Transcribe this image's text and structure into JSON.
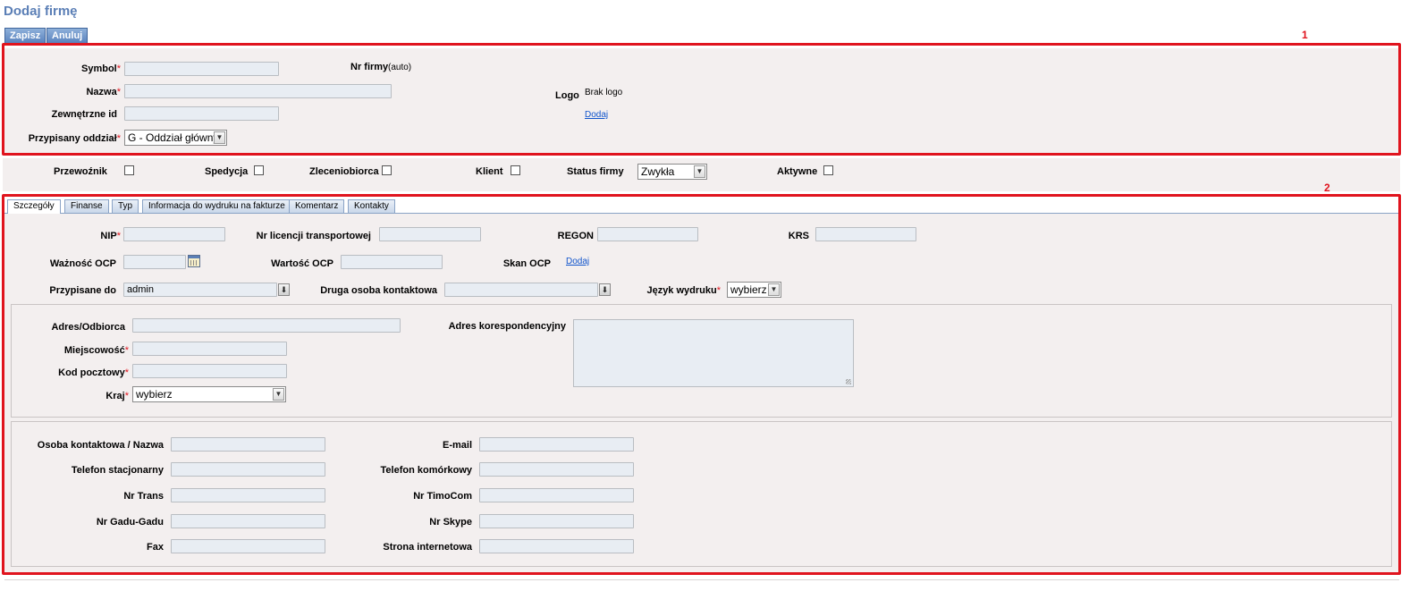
{
  "page": {
    "title": "Dodaj firmę"
  },
  "toolbar": {
    "save_label": "Zapisz",
    "cancel_label": "Anuluj"
  },
  "annotations": {
    "box1": "1",
    "box2": "2"
  },
  "basic": {
    "symbol_label": "Symbol",
    "name_label": "Nazwa",
    "external_id_label": "Zewnętrzne id",
    "branch_label": "Przypisany oddział",
    "branch_value": "G - Oddział główny",
    "company_no_label": "Nr firmy",
    "company_no_value": "(auto)",
    "logo_label": "Logo",
    "logo_value": "Brak logo",
    "logo_add_link": "Dodaj"
  },
  "flags": {
    "carrier_label": "Przewoźnik",
    "forwarding_label": "Spedycja",
    "client_order_label": "Zleceniobiorca",
    "client_label": "Klient",
    "status_label": "Status firmy",
    "status_value": "Zwykła",
    "active_label": "Aktywne"
  },
  "tabs": [
    {
      "label": "Szczegóły",
      "active": true
    },
    {
      "label": "Finanse"
    },
    {
      "label": "Typ"
    },
    {
      "label": "Informacja do wydruku na fakturze"
    },
    {
      "label": "Komentarz"
    },
    {
      "label": "Kontakty"
    }
  ],
  "details": {
    "nip_label": "NIP",
    "license_label": "Nr licencji transportowej",
    "regon_label": "REGON",
    "krs_label": "KRS",
    "ocp_validity_label": "Ważność OCP",
    "ocp_value_label": "Wartość OCP",
    "ocp_scan_label": "Skan OCP",
    "ocp_scan_link": "Dodaj",
    "assigned_label": "Przypisane do",
    "assigned_value": "admin",
    "second_contact_label": "Druga osoba kontaktowa",
    "print_lang_label": "Język wydruku",
    "print_lang_value": "wybierz"
  },
  "address": {
    "address_label": "Adres/Odbiorca",
    "city_label": "Miejscowość",
    "postal_label": "Kod pocztowy",
    "country_label": "Kraj",
    "country_value": "wybierz",
    "corr_label": "Adres korespondencyjny"
  },
  "contacts": {
    "contact_name_label": "Osoba kontaktowa / Nazwa",
    "landline_label": "Telefon stacjonarny",
    "trans_label": "Nr Trans",
    "gg_label": "Nr Gadu-Gadu",
    "fax_label": "Fax",
    "email_label": "E-mail",
    "mobile_label": "Telefon komórkowy",
    "timocom_label": "Nr TimoCom",
    "skype_label": "Nr Skype",
    "website_label": "Strona internetowa"
  }
}
